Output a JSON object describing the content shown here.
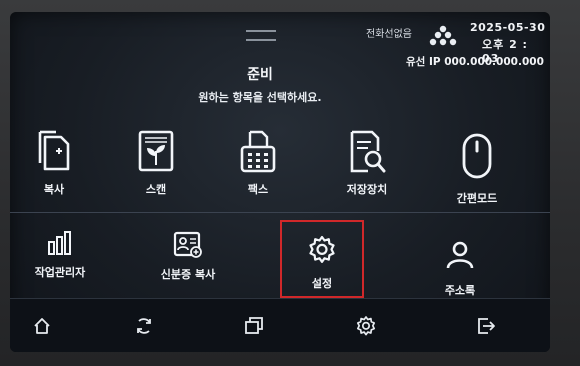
{
  "status": {
    "line_status": "전화선없음",
    "date": "2025-05-30",
    "time": "오후 2 : 03",
    "ip": "유선 IP 000.000.000.000"
  },
  "header": {
    "title": "준비",
    "subtitle": "원하는 항목을 선택하세요."
  },
  "tiles": {
    "copy": "복사",
    "scan": "스캔",
    "fax": "팩스",
    "storage": "저장장치",
    "easy_mode": "간편모드",
    "job_manager": "작업관리자",
    "id_copy": "신분증 복사",
    "settings": "설정",
    "address_book": "주소록"
  },
  "bottom_bar": {
    "items": [
      "home-icon",
      "refresh-icon",
      "windows-icon",
      "gear-icon",
      "logout-icon"
    ]
  },
  "colors": {
    "highlight": "#d0282a",
    "text": "#f2f5f9",
    "screen_bg": "#181d24"
  }
}
